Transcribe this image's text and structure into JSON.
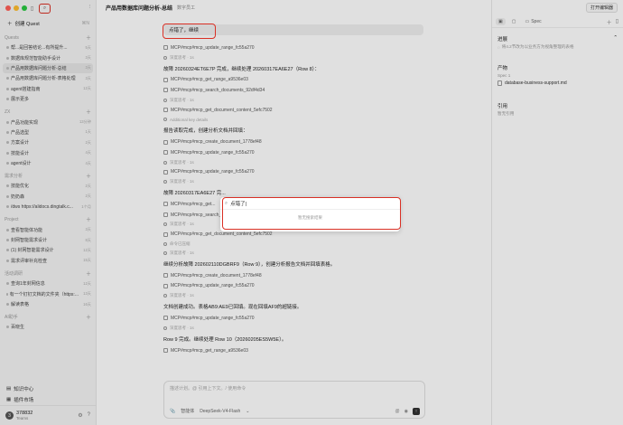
{
  "sidebar": {
    "new_quest": "创建 Quest",
    "new_quest_shortcut": "⌘N",
    "sections": [
      {
        "title": "Quests",
        "items": [
          {
            "label": "帮...是回答结论...有所提升...",
            "count": "5天",
            "active": false
          },
          {
            "label": "数据库规范智能助手设计",
            "count": "3天",
            "active": false
          },
          {
            "label": "产品用数据库问题分析-总结",
            "count": "3天",
            "active": true
          },
          {
            "label": "产品用数据库问题分析-表格处理",
            "count": "3天",
            "active": false
          },
          {
            "label": "agent搭建指南",
            "count": "12天",
            "active": false
          },
          {
            "label": "展示更多",
            "count": "",
            "active": false
          }
        ]
      },
      {
        "title": "ZX",
        "items": [
          {
            "label": "产品功能实现",
            "count": "13分钟",
            "active": false
          },
          {
            "label": "产品选型",
            "count": "1天",
            "active": false
          },
          {
            "label": "方案设计",
            "count": "2天",
            "active": false
          },
          {
            "label": "技能设计",
            "count": "4天",
            "active": false
          },
          {
            "label": "agent设计",
            "count": "4天",
            "active": false
          }
        ]
      },
      {
        "title": "需求分析",
        "items": [
          {
            "label": "技能优化",
            "count": "2天",
            "active": false
          },
          {
            "label": "奶奶森",
            "count": "2天",
            "active": false
          },
          {
            "label": "/dws https://alidocs.dingtalk.c...",
            "count": "1个月",
            "active": false
          }
        ]
      },
      {
        "title": "Project",
        "items": [
          {
            "label": "查看智能体功能",
            "count": "3天",
            "active": false
          },
          {
            "label": "封网智能需求设计",
            "count": "8天",
            "active": false
          },
          {
            "label": "(1) 封网智能需求设计",
            "count": "12天",
            "active": false
          },
          {
            "label": "需求评审补充检查",
            "count": "15天",
            "active": false
          }
        ]
      },
      {
        "title": "活动调研",
        "items": [
          {
            "label": "查询1年封网信息",
            "count": "12天",
            "active": false
          },
          {
            "label": "有一个钉钉文档的文件夹（https:...",
            "count": "13天",
            "active": false
          },
          {
            "label": "解读表格",
            "count": "16天",
            "active": false
          }
        ]
      },
      {
        "title": "AI助手",
        "items": [
          {
            "label": "百晓生",
            "count": "",
            "active": false
          }
        ]
      }
    ],
    "bottom_items": [
      "知识中心",
      "插件市场"
    ],
    "user": {
      "initial": "3",
      "name": "378832",
      "sub": "Teams"
    }
  },
  "main": {
    "title": "产品用数据库问题分析-总结",
    "tag": "数字员工",
    "user_message": "点错了，继续",
    "lines": [
      {
        "kind": "tool",
        "text": "MCP#mcp#mcp_update_range_fc55a270"
      },
      {
        "kind": "sub",
        "text": "深度思考 · 1s"
      },
      {
        "kind": "head",
        "text": "故障 20260324ET6E7P 完成，继续处理 20260317EA6E27（Row 8）："
      },
      {
        "kind": "tool",
        "text": "MCP#mcp#mcp_get_range_a9536e03"
      },
      {
        "kind": "tool",
        "text": "MCP#mcp#mcp_search_documents_92df4d34"
      },
      {
        "kind": "sub",
        "text": "深度思考 · 1s"
      },
      {
        "kind": "tool",
        "text": "MCP#mcp#mcp_get_document_content_5efc7502"
      },
      {
        "kind": "sub",
        "text": "Additional key details"
      },
      {
        "kind": "head",
        "text": "报告读取完成，创建分析文档并回填："
      },
      {
        "kind": "tool",
        "text": "MCP#mcp#mcp_create_document_1778ef48"
      },
      {
        "kind": "tool",
        "text": "MCP#mcp#mcp_update_range_fc55a270"
      },
      {
        "kind": "sub",
        "text": "深度思考 · 1s"
      },
      {
        "kind": "tool",
        "text": "MCP#mcp#mcp_update_range_fc55a270"
      },
      {
        "kind": "sub",
        "text": "深度思考 · 1s"
      },
      {
        "kind": "head",
        "text": "故障 20260317EA6E27 完..."
      },
      {
        "kind": "tool",
        "text": "MCP#mcp#mcp_get..."
      },
      {
        "kind": "tool",
        "text": "MCP#mcp#mcp_search_documents_92df4d34"
      },
      {
        "kind": "sub",
        "text": "深度思考 · 1s"
      },
      {
        "kind": "tool",
        "text": "MCP#mcp#mcp_get_document_content_5efc7502"
      },
      {
        "kind": "sub",
        "text": "命令已压缩"
      },
      {
        "kind": "sub",
        "text": "深度思考 · 1s"
      },
      {
        "kind": "head",
        "text": "继续分析故障 202602110DGBRF9（Row 9），创建分析报告文档并回填表格。"
      },
      {
        "kind": "tool",
        "text": "MCP#mcp#mcp_create_document_1778ef48"
      },
      {
        "kind": "tool",
        "text": "MCP#mcp#mcp_update_range_fc55a270"
      },
      {
        "kind": "sub",
        "text": "深度思考 · 1s"
      },
      {
        "kind": "head",
        "text": "文档创建成功。表格AB9:AE9已回填。现在回填AF9的超链接。"
      },
      {
        "kind": "tool",
        "text": "MCP#mcp#mcp_update_range_fc55a270"
      },
      {
        "kind": "sub",
        "text": "深度思考 · 1s"
      },
      {
        "kind": "head",
        "text": "Row 9 完成。继续处理 Row 10（20260205ES5W5E）。"
      },
      {
        "kind": "tool",
        "text": "MCP#mcp#mcp_get_range_a9536e03"
      }
    ],
    "composer": {
      "placeholder": "描述计划。@ 引用上下文。/ 使用命令",
      "agent": "智能体",
      "model": "DeepSeek-V4-Flash"
    }
  },
  "right": {
    "open_editor": "打开编辑器",
    "tabs": [
      "",
      "",
      "Spec"
    ],
    "progress_title": "进展",
    "progress_note": "将4.2节改为以业务方为视角整理的表格",
    "artifacts_title": "产物",
    "spec_label": "Spec 1",
    "artifact_file": "database-business-support.md",
    "refs_title": "引用",
    "refs_note": "暂无引用"
  },
  "popup": {
    "query": "点错了|",
    "empty": "暂无搜索结果"
  },
  "colors": {
    "highlight": "#d93025",
    "red": "#ff5f57",
    "yellow": "#febc2e",
    "green": "#28c840"
  }
}
